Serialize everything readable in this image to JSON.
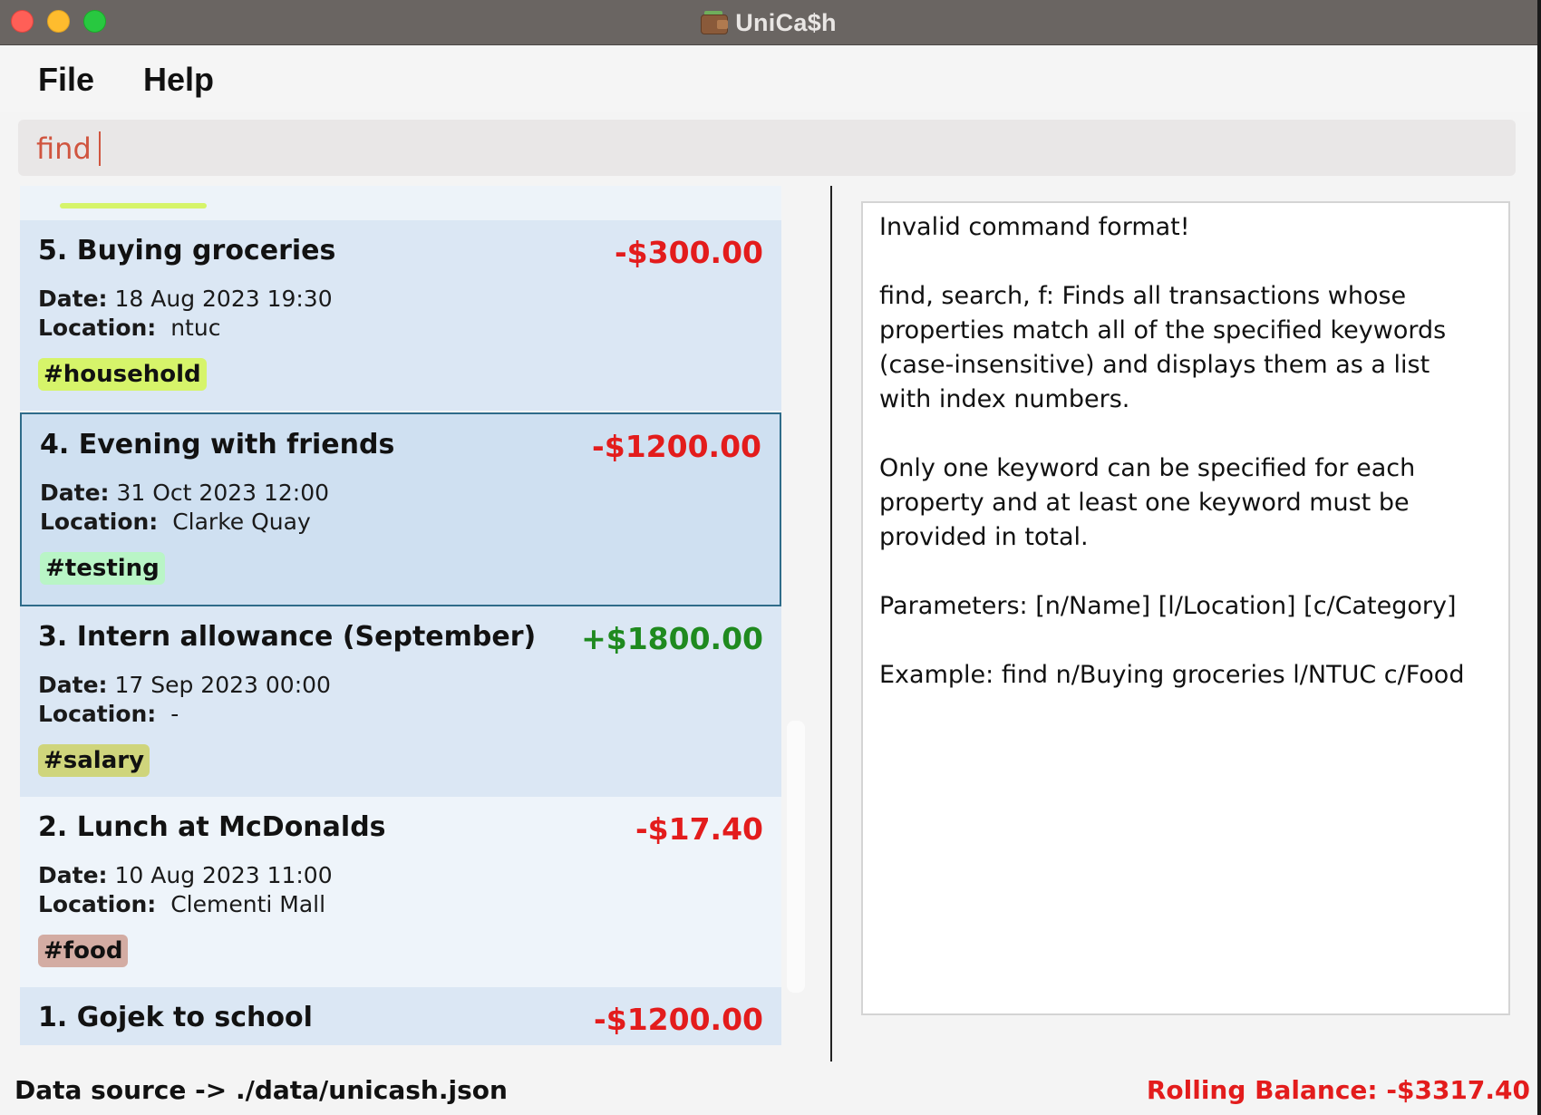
{
  "window": {
    "title": "UniCa$h",
    "app_icon": "wallet-icon"
  },
  "menu": {
    "file": "File",
    "help": "Help"
  },
  "command": {
    "value": "find"
  },
  "transactions": [
    {
      "index_name": "5. Buying groceries",
      "amount": "-$300.00",
      "amount_sign": "negative",
      "date_label": "Date:",
      "date": "18 Aug 2023 19:30",
      "location_label": "Location:",
      "location": "ntuc",
      "tag": "#household",
      "tag_color": "#d6f46a"
    },
    {
      "index_name": "4. Evening with friends",
      "amount": "-$1200.00",
      "amount_sign": "negative",
      "date_label": "Date:",
      "date": "31 Oct 2023 12:00",
      "location_label": "Location:",
      "location": "Clarke Quay",
      "tag": "#testing",
      "tag_color": "#b9f5c6",
      "selected": true
    },
    {
      "index_name": "3. Intern allowance (September)",
      "amount": "+$1800.00",
      "amount_sign": "positive",
      "date_label": "Date:",
      "date": "17 Sep 2023 00:00",
      "location_label": "Location:",
      "location": "-",
      "tag": "#salary",
      "tag_color": "#cfd57c"
    },
    {
      "index_name": "2. Lunch at McDonalds",
      "amount": "-$17.40",
      "amount_sign": "negative",
      "date_label": "Date:",
      "date": "10 Aug 2023 11:00",
      "location_label": "Location:",
      "location": "Clementi Mall",
      "tag": "#food",
      "tag_color": "#d3aca3"
    },
    {
      "index_name": "1. Gojek to school",
      "amount": "-$1200.00",
      "amount_sign": "negative"
    }
  ],
  "result": {
    "line1": "Invalid command format!",
    "line2": "find, search, f: Finds all transactions whose",
    "line3": "properties match all of the specified keywords",
    "line4": "(case-insensitive) and displays them as a list",
    "line5": "with index numbers.",
    "line6": "Only one keyword can be specified for each",
    "line7": "property and at least one keyword must be",
    "line8": "provided in total.",
    "line9": "Parameters: [n/Name] [l/Location] [c/Category]",
    "line10": "Example: find n/Buying groceries l/NTUC c/Food"
  },
  "status": {
    "data_source": "Data source -> ./data/unicash.json",
    "rolling_balance": "Rolling Balance: -$3317.40"
  },
  "colors": {
    "negative": "#e31c1c",
    "positive": "#1f8a1f",
    "command_text": "#d0553f",
    "selected_border": "#2f6c8a"
  }
}
